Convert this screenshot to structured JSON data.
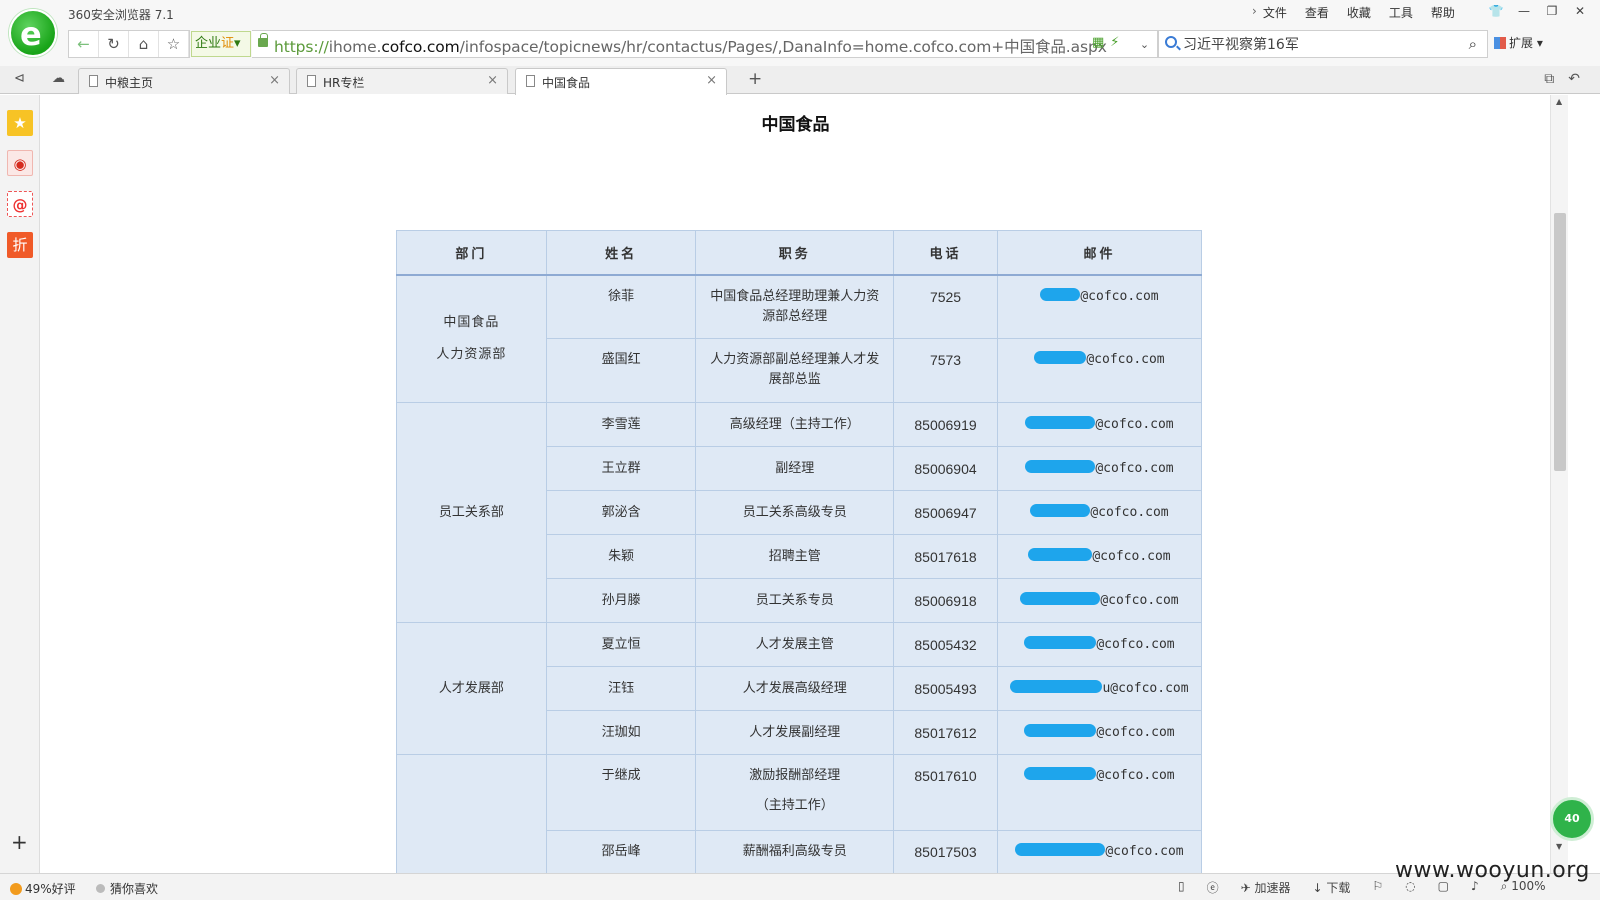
{
  "app": {
    "title": "360安全浏览器 7.1",
    "menu": [
      "文件",
      "查看",
      "收藏",
      "工具",
      "帮助"
    ]
  },
  "address": {
    "enterprise_label": "企业",
    "cert_label": "证",
    "url_proto": "https://",
    "url_pre": "ihome.",
    "url_host": "cofco.com",
    "url_path": "/infospace/topicnews/hr/contactus/Pages/,DanaInfo=home.cofco.com+中国食品.aspx",
    "search_value": "习近平视察第16军",
    "ext_label": "扩展"
  },
  "tabs": [
    {
      "label": "中粮主页"
    },
    {
      "label": "HR专栏"
    },
    {
      "label": "中国食品"
    }
  ],
  "page": {
    "title": "中国食品"
  },
  "table": {
    "headers": [
      "部门",
      "姓名",
      "职务",
      "电话",
      "邮件"
    ],
    "departments": [
      "中国食品\n人力资源部",
      "员工关系部",
      "人才发展部",
      ""
    ],
    "rows": [
      {
        "name": "徐菲",
        "title": "中国食品总经理助理兼人力资源部总经理",
        "phone": "7525",
        "email_visible": "@cofco.com"
      },
      {
        "name": "盛国红",
        "title": "人力资源部副总经理兼人才发展部总监",
        "phone": "7573",
        "email_visible": "@cofco.com"
      },
      {
        "name": "李雪莲",
        "title": "高级经理（主持工作）",
        "phone": "85006919",
        "email_visible": "@cofco.com"
      },
      {
        "name": "王立群",
        "title": "副经理",
        "phone": "85006904",
        "email_visible": "@cofco.com"
      },
      {
        "name": "郭泌含",
        "title": "员工关系高级专员",
        "phone": "85006947",
        "email_visible": "@cofco.com"
      },
      {
        "name": "朱颖",
        "title": "招聘主管",
        "phone": "85017618",
        "email_visible": "@cofco.com"
      },
      {
        "name": "孙月滕",
        "title": "员工关系专员",
        "phone": "85006918",
        "email_visible": "@cofco.com"
      },
      {
        "name": "夏立恒",
        "title": "人才发展主管",
        "phone": "85005432",
        "email_visible": "@cofco.com"
      },
      {
        "name": "汪钰",
        "title": "人才发展高级经理",
        "phone": "85005493",
        "email_visible": "u@cofco.com"
      },
      {
        "name": "汪珈如",
        "title": "人才发展副经理",
        "phone": "85017612",
        "email_visible": "@cofco.com"
      },
      {
        "name": "于继成",
        "title": "激励报酬部经理\n（主持工作）",
        "phone": "85017610",
        "email_visible": "@cofco.com"
      },
      {
        "name": "邵岳峰",
        "title": "薪酬福利高级专员",
        "phone": "85017503",
        "email_visible": "@cofco.com"
      }
    ]
  },
  "status": {
    "rating": "49%好评",
    "guess": "猜你喜欢",
    "accelerator": "加速器",
    "download": "下载",
    "zoom": "100%"
  },
  "watermark": "www.wooyun.org",
  "float_badge": "40",
  "colors": {
    "table_bg": "#dfe9f5",
    "table_border": "#b9cde5",
    "redaction": "#1ea5ec",
    "brand_green": "#18a418"
  }
}
